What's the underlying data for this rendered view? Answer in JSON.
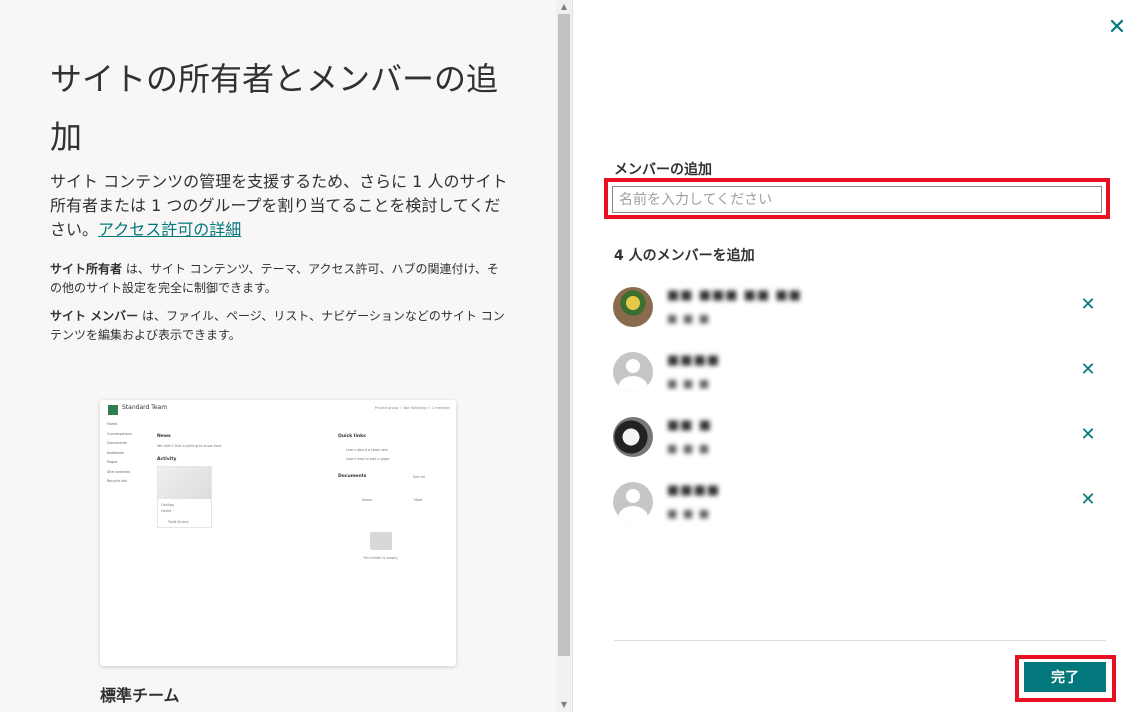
{
  "left": {
    "title": "サイトの所有者とメンバーの追加",
    "description": "サイト コンテンツの管理を支援するため、さらに 1 人のサイト所有者または 1 つのグループを割り当てることを検討してください。",
    "link": "アクセス許可の詳細",
    "owner_term": "サイト所有者",
    "owner_desc": " は、サイト コンテンツ、テーマ、アクセス許可、ハブの関連付け、その他のサイト設定を完全に制御できます。",
    "member_term": "サイト メンバー",
    "member_desc": " は、ファイル、ページ、リスト、ナビゲーションなどのサイト コンテンツを編集および表示できます。",
    "preview_caption": "標準チーム",
    "preview": {
      "site_name": "Standard Team",
      "top_links": "Private group   ☆ Not following   ⚇ 1 member",
      "nav": [
        "Home",
        "Conversations",
        "Documents",
        "Notebook",
        "Pages",
        "Site contents",
        "Recycle bin"
      ],
      "news_heading": "News",
      "news_text": "We didn't find anything to show here",
      "activity_heading": "Activity",
      "card_title": "GetApp",
      "card_sub": "Home",
      "card_person": "Todd Kinsey",
      "quicklinks_heading": "Quick links",
      "quicklink_1": "Learn about a team site",
      "quicklink_2": "Learn how to add a page",
      "documents_heading": "Documents",
      "see_all": "See all",
      "doc_col_name": "Name",
      "doc_col_modified": "Modi",
      "empty_text": "This folder is empty"
    }
  },
  "right": {
    "close_label": "✕",
    "add_label": "メンバーの追加",
    "input_placeholder": "名前を入力してください",
    "count_label": "4 人のメンバーを追加",
    "members": [
      {
        "name": "■■ ■■■ ■■ ■■",
        "sub": "■ ■  ■"
      },
      {
        "name": "■■■■",
        "sub": "■ ■  ■"
      },
      {
        "name": "■■ ■",
        "sub": "■ ■  ■"
      },
      {
        "name": "■■■■",
        "sub": "■ ■  ■"
      }
    ],
    "remove_label": "✕",
    "done_label": "完了"
  }
}
